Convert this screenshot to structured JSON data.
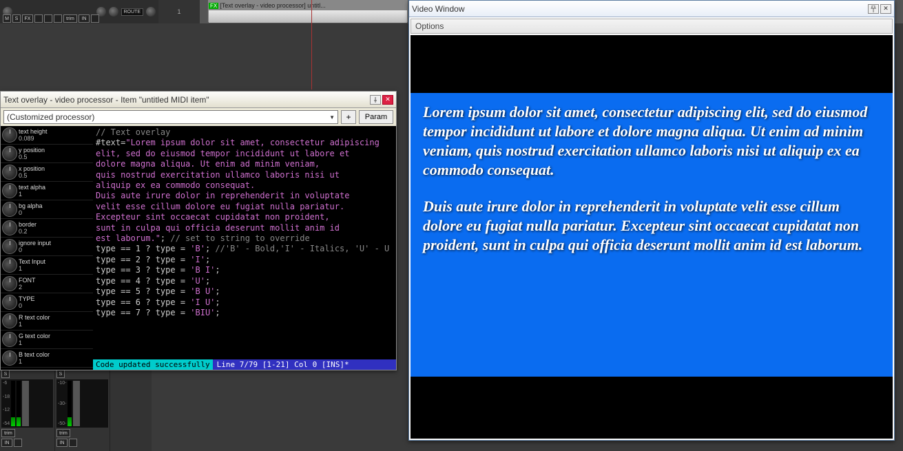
{
  "daw": {
    "route_label": "ROUTE",
    "buttons": [
      "M",
      "S",
      "FX",
      "",
      "",
      "",
      "trim",
      "IN"
    ],
    "track_number": "1",
    "clip_label": "[Text overlay - video processor] untitl...",
    "fx_label": "FX"
  },
  "mixer": {
    "s_label": "S",
    "trim_label": "trim",
    "in_label": "IN",
    "db_labels": [
      "-6",
      "-18",
      "-12",
      "-54"
    ],
    "scale_labels": [
      "-10-",
      "-30-",
      "-50-"
    ]
  },
  "proc": {
    "title": "Text overlay - video processor - Item \"untitled MIDI item\"",
    "preset": "(Customized processor)",
    "plus": "+",
    "param": "Param",
    "knobs": [
      {
        "name": "text height",
        "val": "0.089"
      },
      {
        "name": "y position",
        "val": "0.5"
      },
      {
        "name": "x position",
        "val": "0.5"
      },
      {
        "name": "text alpha",
        "val": "1"
      },
      {
        "name": "bg alpha",
        "val": "0"
      },
      {
        "name": "border",
        "val": "0.2"
      },
      {
        "name": "ignore input",
        "val": "0"
      },
      {
        "name": "Text Input",
        "val": "1"
      },
      {
        "name": "FONT",
        "val": "2"
      },
      {
        "name": "TYPE",
        "val": "0"
      },
      {
        "name": "R text color",
        "val": "1"
      },
      {
        "name": "G text color",
        "val": "1"
      },
      {
        "name": "B text color",
        "val": "1"
      }
    ],
    "code": {
      "l1": "// Text overlay",
      "l2a": "#text=",
      "l2b": "\"Lorem ipsum dolor sit amet, consectetur adipiscing",
      "l3": "elit, sed do eiusmod tempor incididunt ut labore et",
      "l4": "dolore magna aliqua. Ut enim ad minim veniam,",
      "l5": "quis nostrud exercitation ullamco laboris nisi ut",
      "l6": "aliquip ex ea commodo consequat.",
      "l7": "",
      "l8": "Duis aute irure dolor in reprehenderit in voluptate",
      "l9": "velit esse cillum dolore eu fugiat nulla pariatur.",
      "l10": "Excepteur sint occaecat cupidatat non proident,",
      "l11": "sunt in culpa qui officia deserunt mollit anim id",
      "l12a": "est laborum.\"",
      "l12b": "; ",
      "l12c": "// set to string to override",
      "l13": "",
      "t1a": "type == 1 ? type = ",
      "t1b": "'B'",
      "t1c": "; ",
      "t1d": "//'B' - Bold,'I' - Italics, 'U' - U",
      "t2a": "type == 2 ? type = ",
      "t2b": "'I'",
      "t2c": ";",
      "t3a": "type == 3 ? type = ",
      "t3b": "'B I'",
      "t3c": ";",
      "t4a": "type == 4 ? type = ",
      "t4b": "'U'",
      "t4c": ";",
      "t5a": "type == 5 ? type = ",
      "t5b": "'B U'",
      "t5c": ";",
      "t6a": "type == 6 ? type = ",
      "t6b": "'I U'",
      "t6c": ";",
      "t7a": "type == 7 ? type = ",
      "t7b": "'BIU'",
      "t7c": ";"
    },
    "status_l": "Code updated successfully",
    "status_r": "Line 7/79 [1-21] Col 0 [INS]*"
  },
  "video": {
    "title": "Video Window",
    "menu": "Options",
    "p1": "Lorem ipsum dolor sit amet, consectetur adipiscing elit, sed do eiusmod tempor incididunt ut labore et dolore magna aliqua. Ut enim ad minim veniam, quis nostrud exercitation ullamco laboris nisi ut aliquip ex ea commodo consequat.",
    "p2": "Duis aute irure dolor in reprehenderit in voluptate velit esse cillum dolore eu fugiat nulla pariatur. Excepteur sint occaecat cupidatat non proident, sunt in culpa qui officia deserunt mollit anim id est laborum."
  }
}
